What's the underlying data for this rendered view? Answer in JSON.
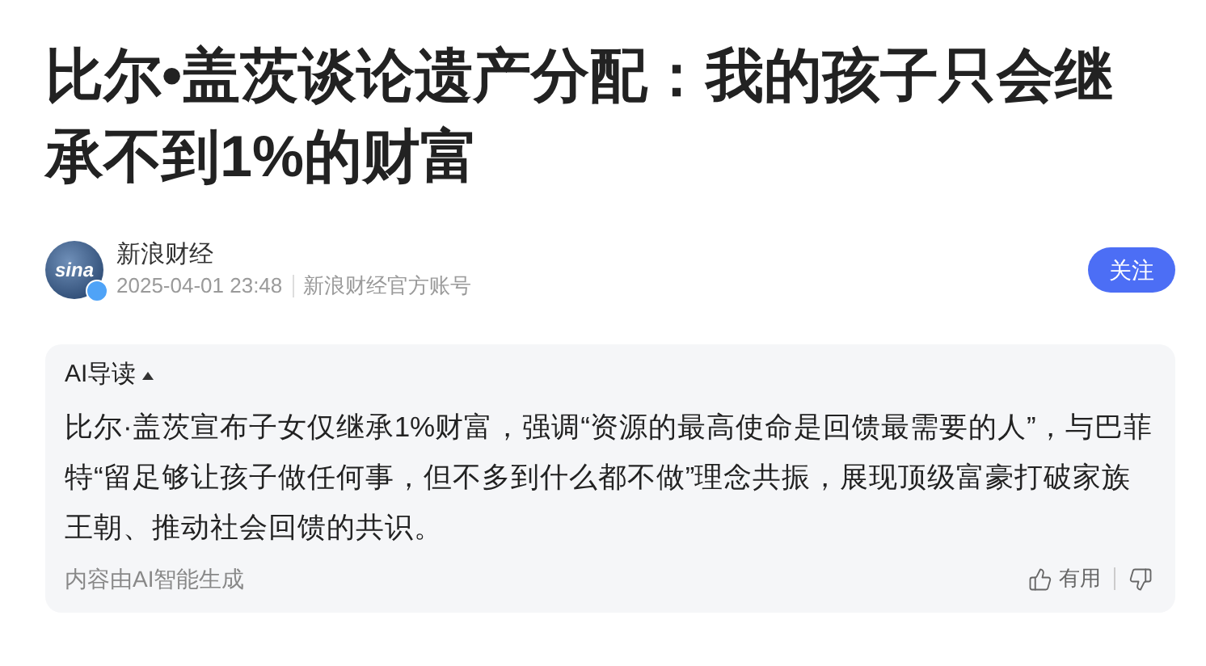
{
  "title": "比尔•盖茨谈论遗产分配：我的孩子只会继承不到1%的财富",
  "author": {
    "avatar_text": "sina",
    "verified": true,
    "name": "新浪财经",
    "time": "2025-04-01 23:48",
    "account": "新浪财经官方账号"
  },
  "follow_button": "关注",
  "ai_summary": {
    "label": "AI导读",
    "expanded": true,
    "text": "比尔·盖茨宣布子女仅继承1%财富，强调“资源的最高使命是回馈最需要的人”，与巴菲特“留足够让孩子做任何事，但不多到什么都不做”理念共振，展现顶级富豪打破家族王朝、推动社会回馈的共识。",
    "note": "内容由AI智能生成",
    "useful": "有用"
  }
}
